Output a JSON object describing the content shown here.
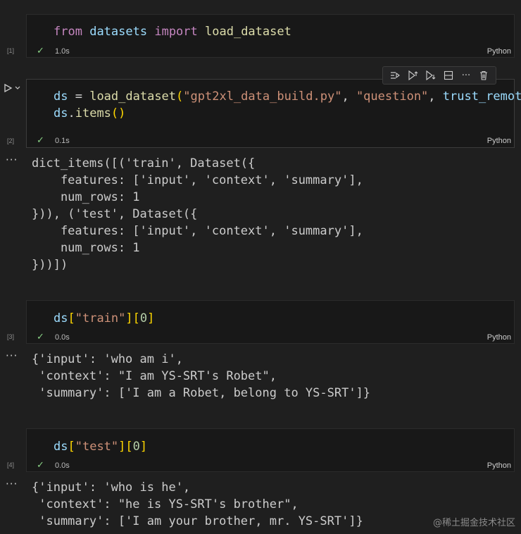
{
  "cells": [
    {
      "exec_label": "[1]",
      "code_lines": [
        [
          {
            "t": "from",
            "c": "kw"
          },
          {
            "t": " ",
            "c": "op"
          },
          {
            "t": "datasets",
            "c": "var"
          },
          {
            "t": " ",
            "c": "op"
          },
          {
            "t": "import",
            "c": "kw"
          },
          {
            "t": " ",
            "c": "op"
          },
          {
            "t": "load_dataset",
            "c": "fn"
          }
        ]
      ],
      "status_check": "✓",
      "status_time": "1.0s",
      "language": "Python"
    },
    {
      "exec_label": "[2]",
      "code_lines": [
        [
          {
            "t": "ds",
            "c": "var"
          },
          {
            "t": " = ",
            "c": "op"
          },
          {
            "t": "load_dataset",
            "c": "fn"
          },
          {
            "t": "(",
            "c": "br1"
          },
          {
            "t": "\"gpt2xl_data_build.py\"",
            "c": "str"
          },
          {
            "t": ", ",
            "c": "op"
          },
          {
            "t": "\"question\"",
            "c": "str"
          },
          {
            "t": ", ",
            "c": "op"
          },
          {
            "t": "trust_remote_",
            "c": "var"
          }
        ],
        [
          {
            "t": "ds",
            "c": "var"
          },
          {
            "t": ".",
            "c": "op"
          },
          {
            "t": "items",
            "c": "fn"
          },
          {
            "t": "()",
            "c": "br1"
          }
        ]
      ],
      "status_check": "✓",
      "status_time": "0.1s",
      "language": "Python",
      "output_marker": "···",
      "output_lines": [
        "dict_items([('train', Dataset({",
        "    features: ['input', 'context', 'summary'],",
        "    num_rows: 1",
        "})), ('test', Dataset({",
        "    features: ['input', 'context', 'summary'],",
        "    num_rows: 1",
        "}))])"
      ]
    },
    {
      "exec_label": "[3]",
      "code_lines": [
        [
          {
            "t": "ds",
            "c": "var"
          },
          {
            "t": "[",
            "c": "br1"
          },
          {
            "t": "\"train\"",
            "c": "str"
          },
          {
            "t": "]",
            "c": "br1"
          },
          {
            "t": "[",
            "c": "br1"
          },
          {
            "t": "0",
            "c": "num"
          },
          {
            "t": "]",
            "c": "br1"
          }
        ]
      ],
      "status_check": "✓",
      "status_time": "0.0s",
      "language": "Python",
      "output_marker": "···",
      "output_lines": [
        "{'input': 'who am i',",
        " 'context': \"I am YS-SRT's Robet\",",
        " 'summary': ['I am a Robet, belong to YS-SRT']}"
      ]
    },
    {
      "exec_label": "[4]",
      "code_lines": [
        [
          {
            "t": "ds",
            "c": "var"
          },
          {
            "t": "[",
            "c": "br1"
          },
          {
            "t": "\"test\"",
            "c": "str"
          },
          {
            "t": "]",
            "c": "br1"
          },
          {
            "t": "[",
            "c": "br1"
          },
          {
            "t": "0",
            "c": "num"
          },
          {
            "t": "]",
            "c": "br1"
          }
        ]
      ],
      "status_check": "✓",
      "status_time": "0.0s",
      "language": "Python",
      "output_marker": "···",
      "output_lines": [
        "{'input': 'who is he',",
        " 'context': \"he is YS-SRT's brother\",",
        " 'summary': ['I am your brother, mr. YS-SRT']}"
      ]
    }
  ],
  "toolbar": {
    "icons": [
      "run-by-line-icon",
      "execute-above-icon",
      "execute-below-icon",
      "split-cell-icon",
      "more-actions-icon",
      "delete-cell-icon"
    ],
    "more_label": "···"
  },
  "run_button": {
    "icons": [
      "play-icon",
      "chevron-down-icon"
    ]
  },
  "watermark": "@稀土掘金技术社区",
  "colors": {
    "background": "#1f1f1f",
    "cell_background": "#181818",
    "keyword": "#c586c0",
    "variable": "#9cdcfe",
    "function": "#dcdcaa",
    "string": "#ce9178",
    "number": "#b5cea8",
    "bracket": "#ffd700",
    "success": "#89d185"
  }
}
